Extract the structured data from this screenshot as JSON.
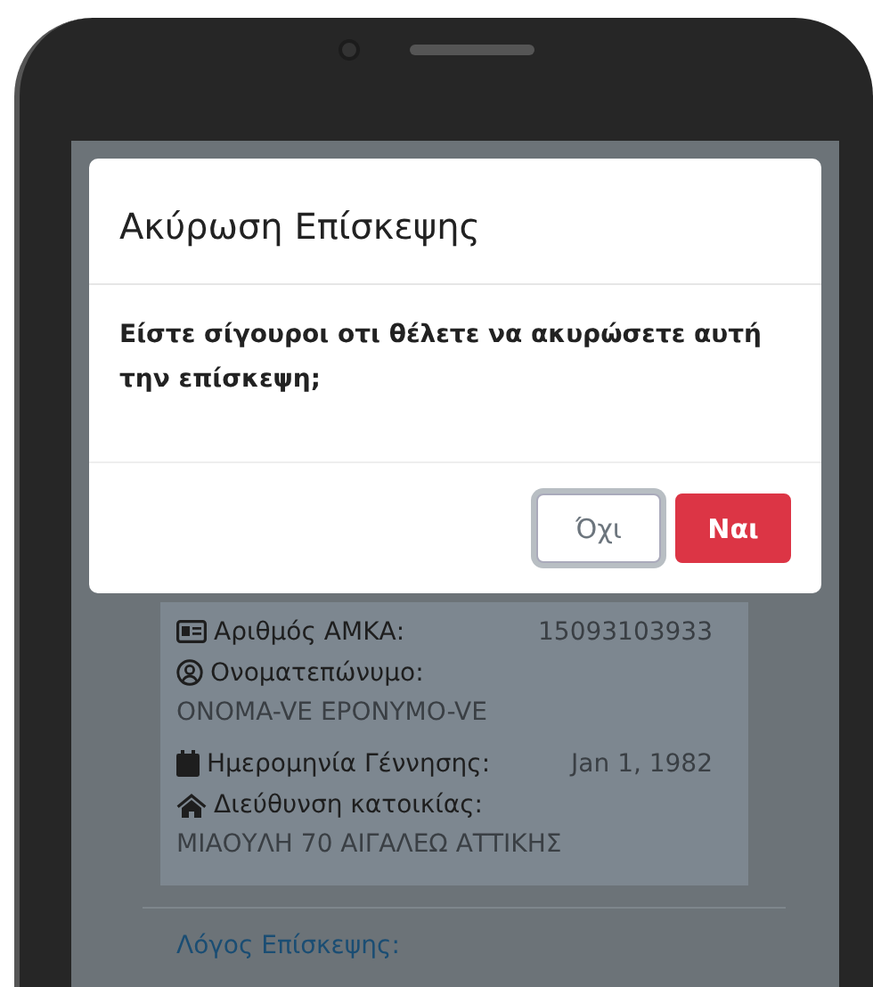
{
  "dialog": {
    "title": "Ακύρωση Επίσκεψης",
    "message": "Είστε σίγουροι οτι θέλετε να ακυρώσετε αυτή την επίσκεψη;",
    "buttons": [
      {
        "label": "Όχι",
        "kind": "secondary",
        "focused": true
      },
      {
        "label": "Ναι",
        "kind": "danger",
        "focused": false
      }
    ]
  },
  "patient": {
    "fields": [
      {
        "kind": "number",
        "label": "Αριθμός ΑΜΚΑ:",
        "value": "15093103933"
      },
      {
        "kind": "person",
        "label": "Ονοματεπώνυμο:",
        "value": "ONOMA-VE EPONYMO-VE"
      },
      {
        "kind": "date",
        "label": "Ημερομηνία Γέννησης:",
        "value": "Jan 1, 1982"
      },
      {
        "kind": "address",
        "label": "Διεύθυνση κατοικίας:",
        "value": "ΜΙΑΟΥΛΗ 70 ΑΙΓΑΛΕΩ ΑΤΤΙΚΗΣ"
      }
    ]
  },
  "section": {
    "label": "Λόγος Επίσκεψης:"
  }
}
